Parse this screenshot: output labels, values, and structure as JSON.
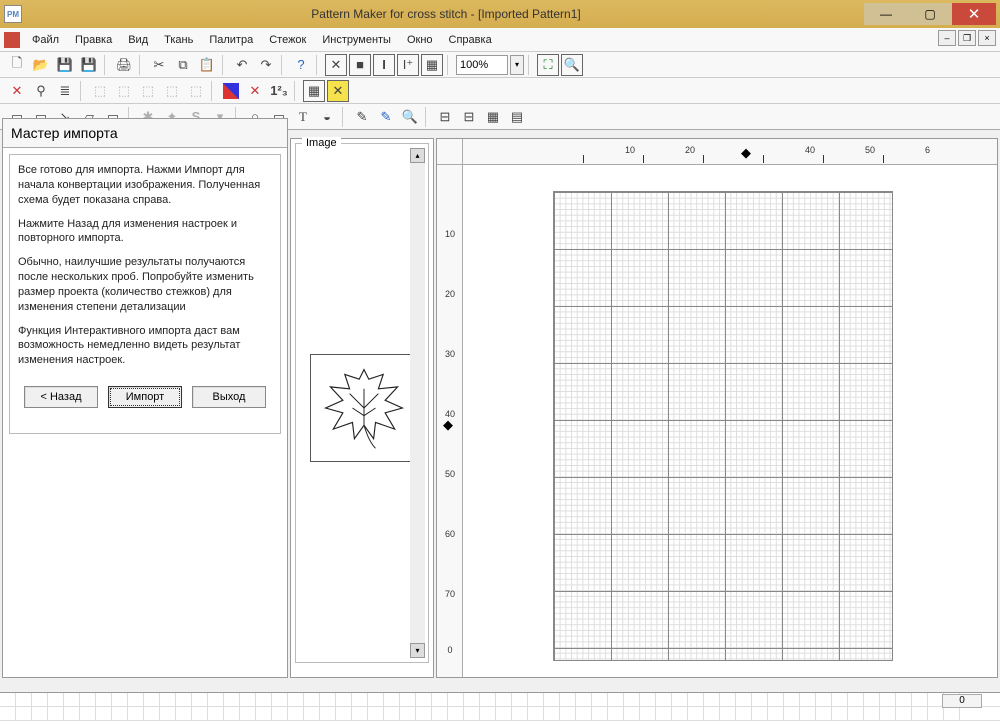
{
  "window": {
    "title": "Pattern Maker for cross stitch - [Imported Pattern1]"
  },
  "menu": {
    "items": [
      "Файл",
      "Правка",
      "Вид",
      "Ткань",
      "Палитра",
      "Стежок",
      "Инструменты",
      "Окно",
      "Справка"
    ]
  },
  "toolbar": {
    "zoom_value": "100%"
  },
  "wizard": {
    "title": "Мастер импорта",
    "p1": "Все готово для импорта.  Нажми Импорт для начала конвертации изображения.  Полученная схема будет показана справа.",
    "p2": "Нажмите Назад для изменения настроек и повторного импорта.",
    "p3": "Обычно, наилучшие результаты получаются после нескольких проб. Попробуйте изменить размер проекта (количество стежков) для изменения степени детализации",
    "p4": "Функция Интерактивного импорта даст вам возможность немедленно видеть результат изменения настроек.",
    "btn_back": "< Назад",
    "btn_import": "Импорт",
    "btn_exit": "Выход"
  },
  "image_panel": {
    "group_label": "Image"
  },
  "rulers": {
    "h_ticks": [
      10,
      20,
      40,
      50,
      6
    ],
    "v_ticks": [
      10,
      20,
      30,
      40,
      50,
      60,
      70,
      0
    ]
  },
  "palette": {
    "count": "0"
  }
}
